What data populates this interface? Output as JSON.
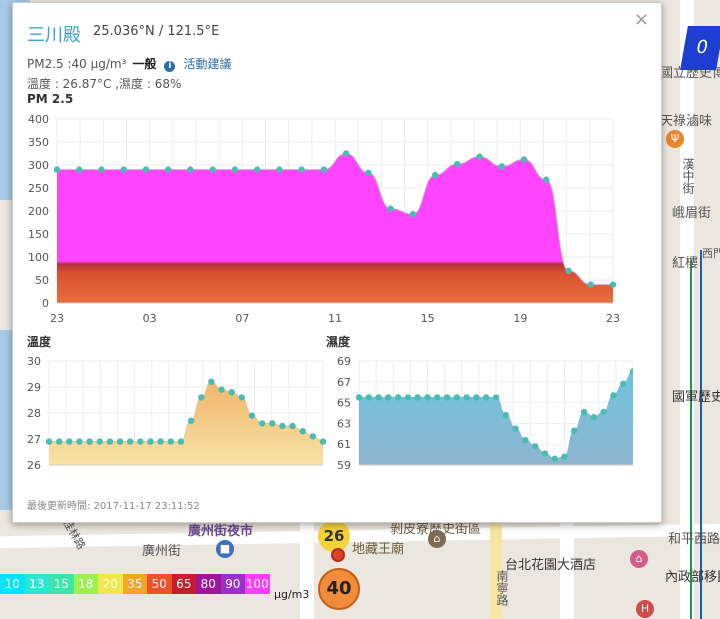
{
  "popup": {
    "title": "三川殿",
    "coords": "25.036°N / 121.5°E",
    "pm_text": "PM2.5 :40 μg/m³",
    "level": "一般",
    "advice": "活動建議",
    "climate": "溫度 : 26.87°C ,濕度 : 68%",
    "pm_chart_title": "PM 2.5",
    "temp_chart_title": "溫度",
    "humid_chart_title": "濕度",
    "updated": "最後更新時間: 2017-11-17 23:11:52",
    "close_glyph": "×"
  },
  "chart_data": [
    {
      "type": "area",
      "title": "PM 2.5",
      "x_ticks": [
        "23",
        "03",
        "07",
        "11",
        "15",
        "19",
        "23"
      ],
      "ylim": [
        0,
        400
      ],
      "y_ticks": [
        0,
        50,
        100,
        150,
        200,
        250,
        300,
        350,
        400
      ],
      "values": [
        290,
        290,
        290,
        290,
        290,
        290,
        290,
        290,
        290,
        290,
        290,
        290,
        290,
        325,
        283,
        205,
        193,
        278,
        302,
        318,
        297,
        312,
        268,
        70,
        40,
        40
      ]
    },
    {
      "type": "area",
      "title": "溫度",
      "ylim": [
        26,
        30
      ],
      "y_ticks": [
        26,
        27,
        28,
        29,
        30
      ],
      "values": [
        26.9,
        26.9,
        26.9,
        26.9,
        26.9,
        26.9,
        26.9,
        26.9,
        26.9,
        26.9,
        26.9,
        26.9,
        26.9,
        26.9,
        27.7,
        28.6,
        29.2,
        28.9,
        28.8,
        28.6,
        27.9,
        27.6,
        27.6,
        27.5,
        27.5,
        27.3,
        27.1,
        26.9
      ]
    },
    {
      "type": "area",
      "title": "濕度",
      "ylim": [
        59,
        69
      ],
      "y_ticks": [
        59,
        61,
        63,
        65,
        67,
        69
      ],
      "values": [
        65.5,
        65.5,
        65.5,
        65.5,
        65.5,
        65.5,
        65.5,
        65.5,
        65.5,
        65.5,
        65.5,
        65.5,
        65.5,
        65.5,
        65.5,
        63.8,
        62.5,
        61.4,
        60.8,
        60.1,
        59.6,
        59.8,
        62.3,
        64.1,
        63.6,
        64.1,
        65.7,
        66.8,
        68
      ]
    }
  ],
  "legend": {
    "values": [
      "10",
      "13",
      "15",
      "18",
      "20",
      "35",
      "50",
      "65",
      "80",
      "90",
      "100"
    ],
    "colors": [
      "#00e5ff",
      "#2ee6d0",
      "#3fe4a8",
      "#9df052",
      "#f1e74a",
      "#f5a623",
      "#f0502a",
      "#c81d2c",
      "#a0149c",
      "#9b2fc9",
      "#ff3dff"
    ],
    "unit": "μg/m3"
  },
  "map": {
    "labels": [
      "國立歷史博物館",
      "天祿滷味",
      "廣州街夜市",
      "廣州街",
      "剝皮寮歷史街區",
      "地藏王廟",
      "台北花園大酒店",
      "內政部移民署",
      "國軍歷史文物館",
      "漢中街",
      "峨眉街",
      "紅樓",
      "西門",
      "桂林路",
      "和平西路",
      "南寧路"
    ],
    "marker_pm": "40",
    "marker_other": "26",
    "badge": "0"
  }
}
